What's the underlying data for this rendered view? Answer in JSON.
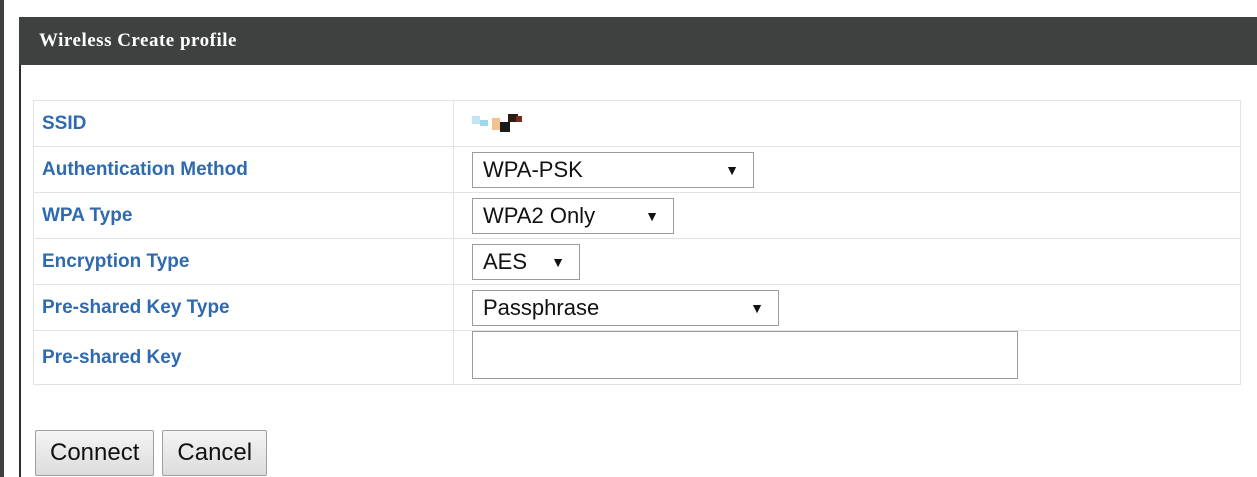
{
  "header": {
    "title": "Wireless Create profile"
  },
  "form": {
    "rows": [
      {
        "label": "SSID",
        "type": "redacted"
      },
      {
        "label": "Authentication Method",
        "type": "select",
        "value": "WPA-PSK"
      },
      {
        "label": "WPA Type",
        "type": "select",
        "value": "WPA2 Only"
      },
      {
        "label": "Encryption Type",
        "type": "select",
        "value": "AES"
      },
      {
        "label": "Pre-shared Key Type",
        "type": "select",
        "value": "Passphrase"
      },
      {
        "label": "Pre-shared Key",
        "type": "text",
        "value": ""
      }
    ]
  },
  "buttons": {
    "connect_label": "Connect",
    "cancel_label": "Cancel"
  },
  "icons": {
    "dropdown": "triangle-down-icon"
  },
  "colors": {
    "header_bg": "#3e413f",
    "label_text": "#2f6ab0"
  }
}
